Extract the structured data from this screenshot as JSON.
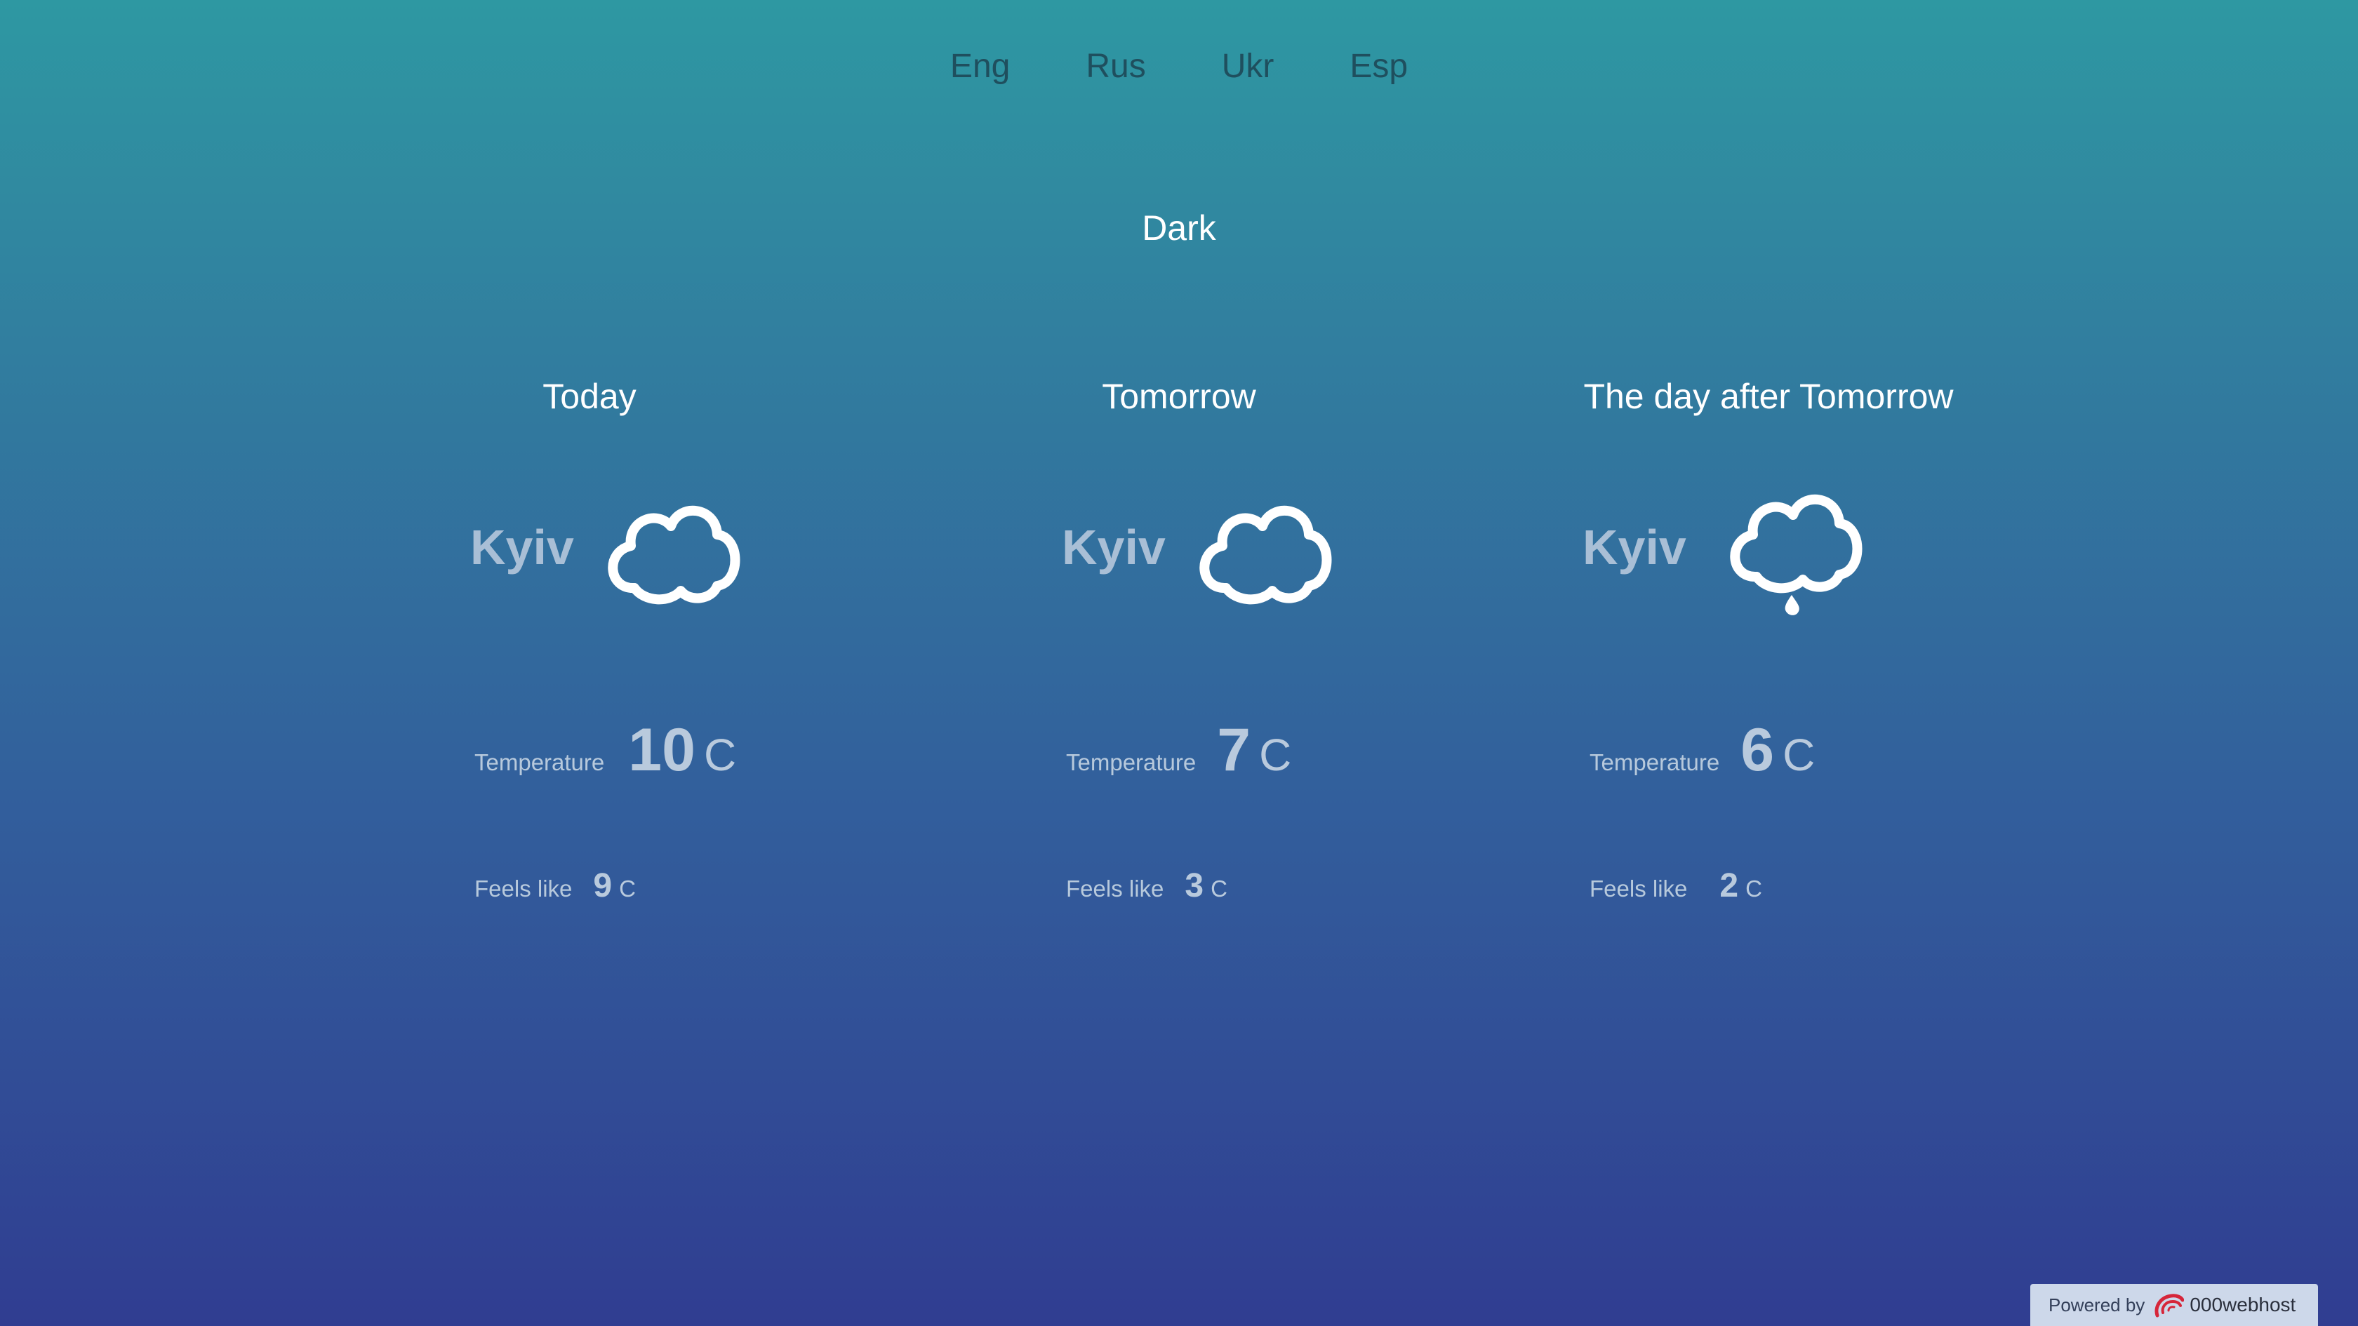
{
  "languages": [
    "Eng",
    "Rus",
    "Ukr",
    "Esp"
  ],
  "theme_toggle": "Dark",
  "days": [
    {
      "title": "Today",
      "city": "Kyiv",
      "icon": "cloud-icon",
      "temperature_label": "Temperature",
      "temperature": "10",
      "temperature_unit": "C",
      "feels_like_label": "Feels like",
      "feels_like": "9",
      "feels_like_unit": "C"
    },
    {
      "title": "Tomorrow",
      "city": "Kyiv",
      "icon": "cloud-icon",
      "temperature_label": "Temperature",
      "temperature": "7",
      "temperature_unit": "C",
      "feels_like_label": "Feels like",
      "feels_like": "3",
      "feels_like_unit": "C"
    },
    {
      "title": "The day after Tomorrow",
      "city": "Kyiv",
      "icon": "rain-cloud-icon",
      "temperature_label": "Temperature",
      "temperature": "6",
      "temperature_unit": "C",
      "feels_like_label": "Feels like",
      "feels_like": "2",
      "feels_like_unit": "C"
    }
  ],
  "footer": {
    "powered_by": "Powered by",
    "host_name": "000webhost",
    "logo_icon": "000webhost-logo-icon",
    "logo_color": "#d6263a"
  },
  "colors": {
    "gradient_top": "#2e98a2",
    "gradient_bottom": "#303d91",
    "language_text": "#1f4f5e",
    "city_text": "#a9bfd6"
  }
}
